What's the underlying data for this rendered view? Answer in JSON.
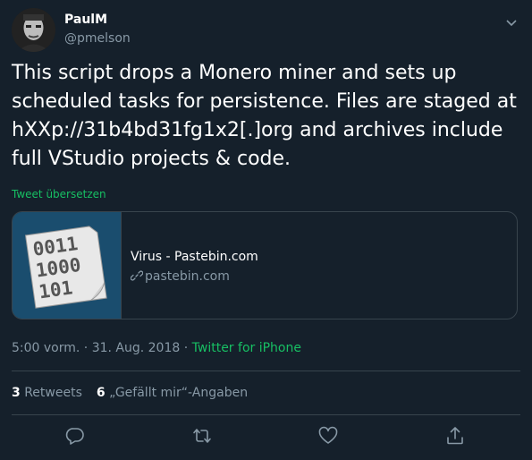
{
  "author": {
    "name": "PaulM",
    "handle": "@pmelson"
  },
  "tweet": {
    "text": "This script drops a Monero miner and sets up scheduled tasks for persistence. Files are staged at hXXp://31b4bd31fg1x2[.]org and archives include full VStudio projects & code.",
    "translate_label": "Tweet übersetzen"
  },
  "card": {
    "title": "Virus - Pastebin.com",
    "domain": "pastebin.com",
    "thumb_text": [
      "0011",
      "1000",
      "101"
    ]
  },
  "meta": {
    "timestamp": "5:00 vorm. · 31. Aug. 2018",
    "separator": " · ",
    "source": "Twitter for iPhone"
  },
  "stats": {
    "retweets_count": "3",
    "retweets_label": "Retweets",
    "likes_count": "6",
    "likes_label": "„Gefällt mir“-Angaben"
  },
  "icons": {
    "reply": "reply-icon",
    "retweet": "retweet-icon",
    "like": "heart-icon",
    "share": "share-icon",
    "more": "chevron-down-icon"
  },
  "colors": {
    "background": "#15202b",
    "secondary_text": "#8899a6",
    "accent_green": "#17bf63",
    "border": "#38444d"
  }
}
